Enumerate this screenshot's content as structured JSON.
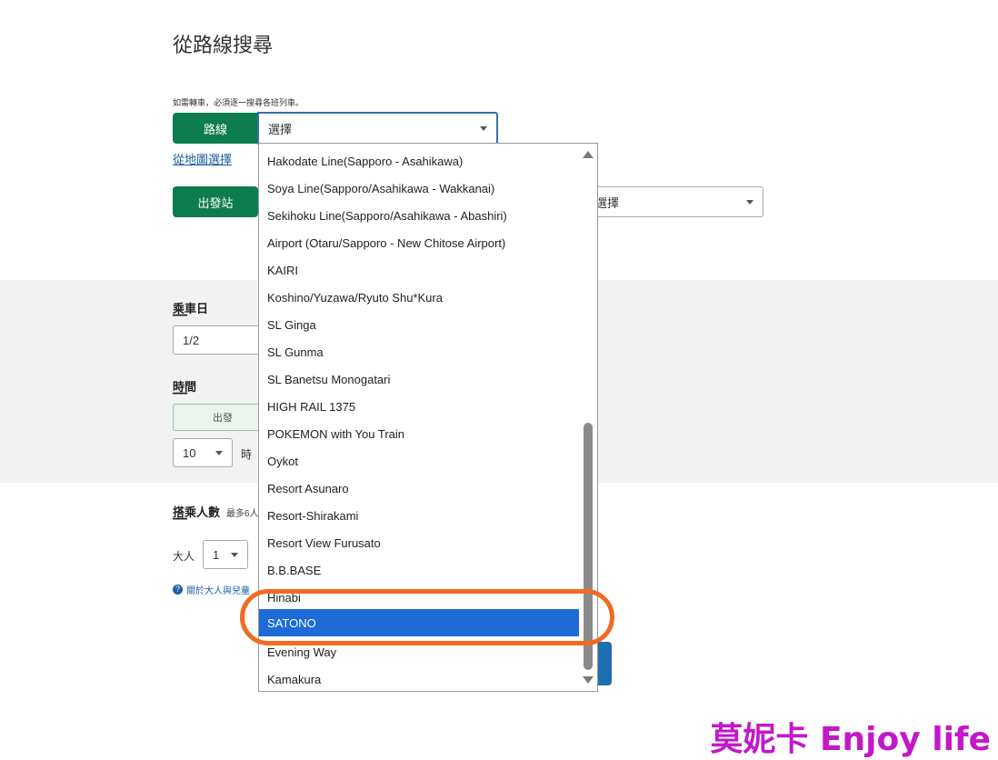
{
  "page": {
    "title": "從路線搜尋",
    "note": "如需轉車，必須逐一搜尋各班列車。"
  },
  "route": {
    "label": "路線",
    "value": "選擇",
    "map_link": "從地圖選擇"
  },
  "departure": {
    "label": "出發站",
    "right_select_value": "選擇"
  },
  "ride_date": {
    "label": "乘車日",
    "dash": "━━━",
    "value": "1/2"
  },
  "time": {
    "label": "時間",
    "dash": "━━━",
    "mode_button": "出發",
    "hour": "10",
    "hour_unit": "時"
  },
  "passengers": {
    "label": "搭乘人數",
    "max": "最多6人",
    "dash": "━━━",
    "adult_label": "大人",
    "adult_value": "1",
    "help_link": "關於大人與兒童"
  },
  "dropdown": {
    "items": [
      "Hakodate Line(Sapporo - Asahikawa)",
      "Soya Line(Sapporo/Asahikawa - Wakkanai)",
      "Sekihoku Line(Sapporo/Asahikawa - Abashiri)",
      "Airport (Otaru/Sapporo - New Chitose Airport)",
      "KAIRI",
      "Koshino/Yuzawa/Ryuto Shu*Kura",
      "SL Ginga",
      "SL Gunma",
      "SL Banetsu Monogatari",
      "HIGH RAIL 1375",
      "POKEMON with You Train",
      "Oykot",
      "Resort Asunaro",
      "Resort-Shirakami",
      "Resort View Furusato",
      "B.B.BASE",
      "Hinabi",
      "SATONO",
      "Evening Way",
      "Kamakura"
    ],
    "selected_index": 17
  },
  "watermark": "莫妮卡 Enjoy life",
  "colors": {
    "green": "#0d7d4f",
    "selected": "#1e6ad6",
    "highlight": "#f26a21",
    "watermark": "#c318c9"
  }
}
